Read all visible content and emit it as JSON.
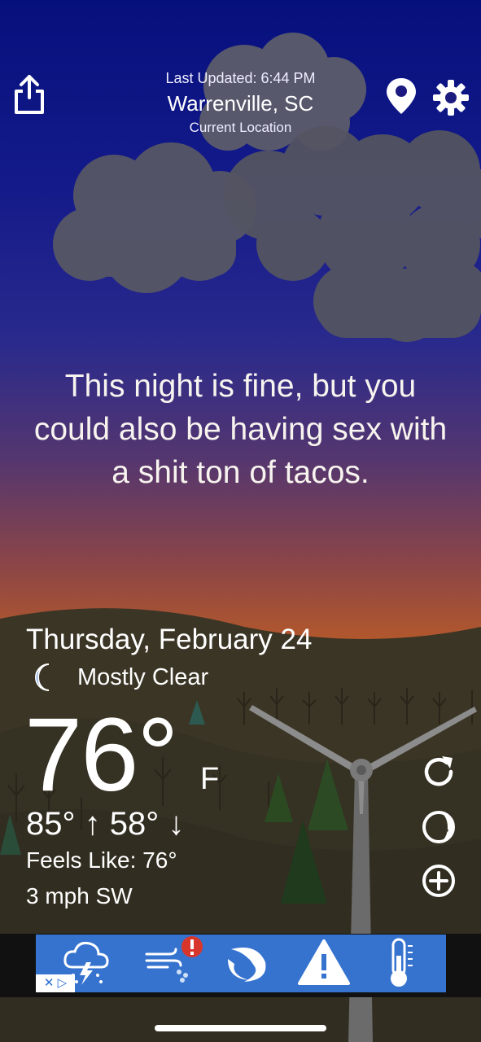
{
  "header": {
    "last_updated": "Last Updated: 6:44 PM",
    "location": "Warrenville, SC",
    "location_sub": "Current Location"
  },
  "quote": "This night is fine, but you could also be having sex with a shit ton of tacos.",
  "weather": {
    "date": "Thursday, February 24",
    "condition": "Mostly Clear",
    "temperature": "76°",
    "unit": "F",
    "high_low": "85° ↑ 58° ↓",
    "feels_like": "Feels Like: 76°",
    "wind": "3 mph SW"
  },
  "icons": {
    "share": "share-icon",
    "location": "location-pin-icon",
    "settings": "gear-icon",
    "condition": "moon-icon",
    "refresh": "refresh-icon",
    "moon_phase": "moon-phase-icon",
    "add": "plus-circle-icon"
  },
  "ad": {
    "badge": "✕ ▷",
    "icons": [
      "thunderstorm-icon",
      "wind-alert-icon",
      "hurricane-icon",
      "warning-icon",
      "thermometer-icon"
    ]
  },
  "colors": {
    "sky_top": "#06107d",
    "sky_sunset": "#c5692a",
    "ground": "#3a3524",
    "ad_blue": "#3673cf",
    "alert_red": "#d9362b"
  }
}
